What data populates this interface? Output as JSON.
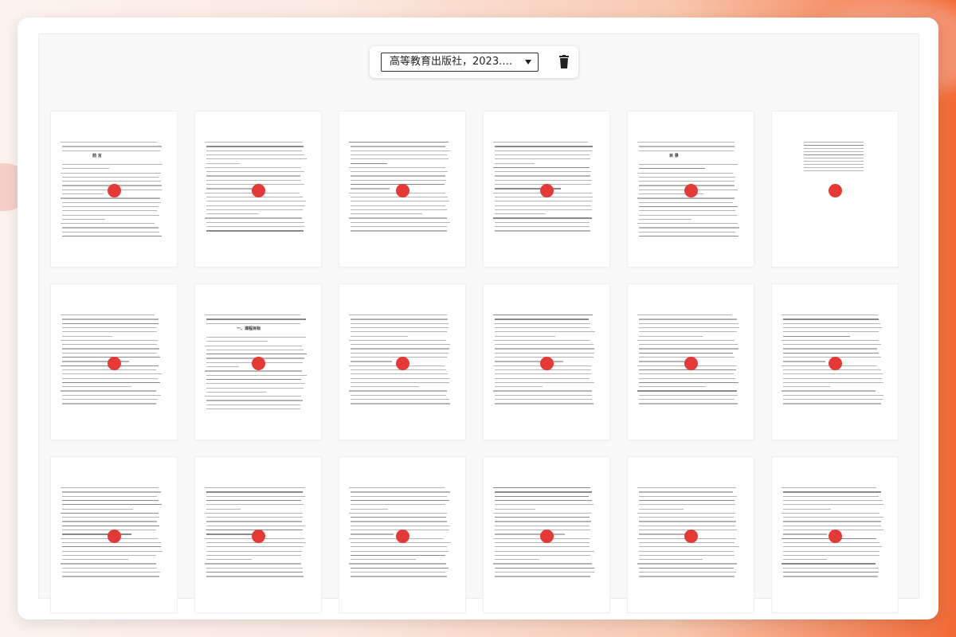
{
  "toolbar": {
    "source_select": {
      "selected": "高等教育出版社，2023. 2.…"
    }
  },
  "icons": {
    "dropdown": "chevron-down-icon",
    "delete": "trash-icon"
  },
  "colors": {
    "marker": "#e53935",
    "accent_gradient_end": "#f26a36"
  },
  "pages": [
    {
      "title": "前    言"
    },
    {
      "title": ""
    },
    {
      "title": ""
    },
    {
      "title": ""
    },
    {
      "title": "目    录"
    },
    {
      "title": ""
    },
    {
      "title": ""
    },
    {
      "title": "一、课程目标"
    },
    {
      "title": ""
    },
    {
      "title": ""
    },
    {
      "title": ""
    },
    {
      "title": ""
    },
    {
      "title": ""
    },
    {
      "title": ""
    },
    {
      "title": ""
    },
    {
      "title": ""
    },
    {
      "title": ""
    },
    {
      "title": ""
    }
  ]
}
